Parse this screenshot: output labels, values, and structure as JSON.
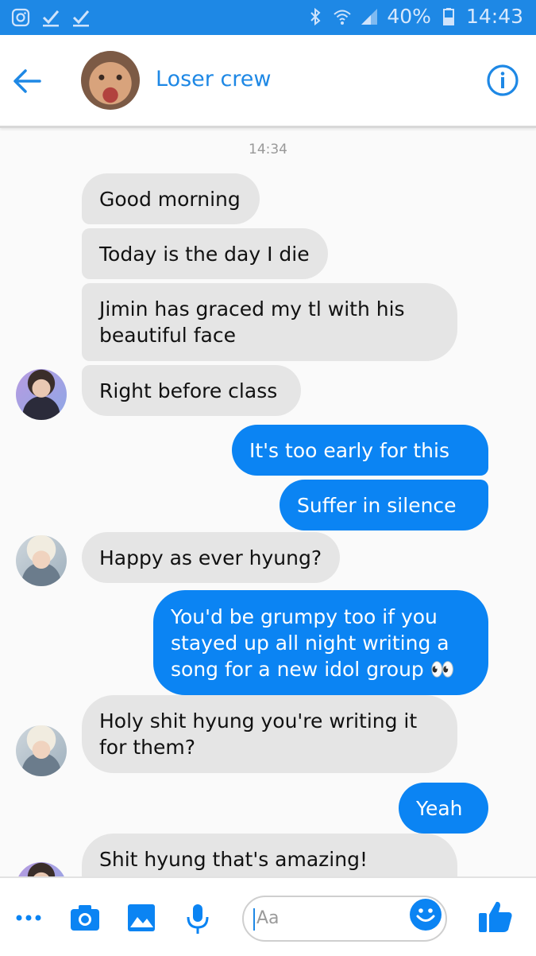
{
  "status_bar": {
    "battery": "40%",
    "time": "14:43"
  },
  "header": {
    "title": "Loser crew"
  },
  "conversation": {
    "timestamp": "14:34",
    "messages": [
      {
        "dir": "in",
        "text": "Good morning"
      },
      {
        "dir": "in",
        "text": "Today is the day I die"
      },
      {
        "dir": "in",
        "text": "Jimin has graced my tl with his beautiful face"
      },
      {
        "dir": "in",
        "text": "Right before class"
      },
      {
        "dir": "out",
        "text": "It's too early for this"
      },
      {
        "dir": "out",
        "text": "Suffer in silence"
      },
      {
        "dir": "in",
        "text": "Happy as ever hyung?"
      },
      {
        "dir": "out",
        "text": "You'd be grumpy too if you stayed up all night writing a song for a new idol group 👀"
      },
      {
        "dir": "in",
        "text": "Holy shit hyung you're writing it for them?"
      },
      {
        "dir": "out",
        "text": "Yeah"
      },
      {
        "dir": "in",
        "text": "Shit hyung that's amazing!"
      }
    ]
  },
  "composer": {
    "placeholder": "Aa"
  },
  "icons": {
    "status_left": [
      "instagram-icon",
      "check-icon",
      "check-icon"
    ],
    "status_right": [
      "bluetooth-icon",
      "wifi-icon",
      "signal-icon",
      "battery-icon"
    ],
    "composer": [
      "more-icon",
      "camera-icon",
      "image-icon",
      "mic-icon",
      "emoji-icon",
      "thumbs-up-icon"
    ]
  },
  "colors": {
    "accent": "#1e88e5",
    "outgoing_bubble": "#0b84f3",
    "incoming_bubble": "#e5e5e5"
  }
}
